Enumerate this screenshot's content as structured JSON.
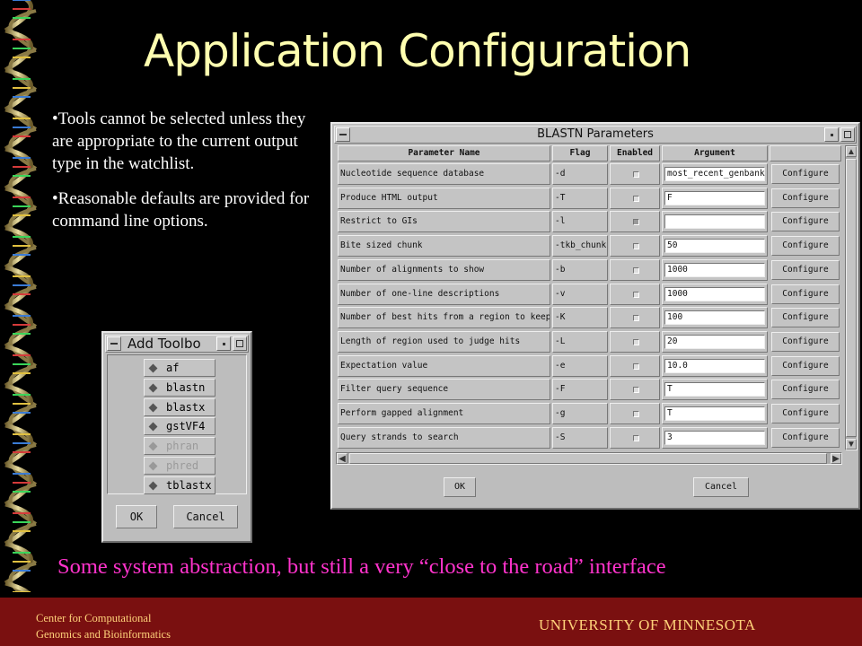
{
  "slide": {
    "title": "Application Configuration",
    "bullets": [
      "•Tools cannot be selected unless they are appropriate to the current output type in the watchlist.",
      "•Reasonable defaults are provided for command line options."
    ],
    "caption": "Some system abstraction, but still a very “close to the road” interface",
    "footer": {
      "left_line1": "Center for Computational",
      "left_line2": "Genomics and Bioinformatics",
      "right": "UNIVERSITY OF MINNESOTA"
    }
  },
  "blastn_window": {
    "title": "BLASTN Parameters",
    "headers": {
      "name": "Parameter Name",
      "flag": "Flag",
      "enabled": "Enabled",
      "argument": "Argument"
    },
    "rows": [
      {
        "name": "Nucleotide sequence database",
        "flag": "-d",
        "enabled": false,
        "argument": "most_recent_genbank",
        "button": "Configure"
      },
      {
        "name": "Produce HTML output",
        "flag": "-T",
        "enabled": false,
        "argument": "F",
        "button": "Configure"
      },
      {
        "name": "Restrict to GIs",
        "flag": "-l",
        "enabled": true,
        "argument": "",
        "button": "Configure"
      },
      {
        "name": "Bite sized chunk",
        "flag": "-tkb_chunk",
        "enabled": false,
        "argument": "50",
        "button": "Configure"
      },
      {
        "name": "Number of alignments to show",
        "flag": "-b",
        "enabled": false,
        "argument": "1000",
        "button": "Configure"
      },
      {
        "name": "Number of one-line descriptions",
        "flag": "-v",
        "enabled": false,
        "argument": "1000",
        "button": "Configure"
      },
      {
        "name": "Number of best hits from a region to keep",
        "flag": "-K",
        "enabled": false,
        "argument": "100",
        "button": "Configure"
      },
      {
        "name": "Length of region used to judge hits",
        "flag": "-L",
        "enabled": false,
        "argument": "20",
        "button": "Configure"
      },
      {
        "name": "Expectation value",
        "flag": "-e",
        "enabled": false,
        "argument": "10.0",
        "button": "Configure"
      },
      {
        "name": "Filter query sequence",
        "flag": "-F",
        "enabled": false,
        "argument": "T",
        "button": "Configure"
      },
      {
        "name": "Perform gapped alignment",
        "flag": "-g",
        "enabled": false,
        "argument": "T",
        "button": "Configure"
      },
      {
        "name": "Query strands to search",
        "flag": "-S",
        "enabled": false,
        "argument": "3",
        "button": "Configure"
      }
    ],
    "ok_label": "OK",
    "cancel_label": "Cancel"
  },
  "toolbox_window": {
    "title": "Add Toolbo",
    "tools": [
      {
        "label": "af",
        "enabled": true
      },
      {
        "label": "blastn",
        "enabled": true
      },
      {
        "label": "blastx",
        "enabled": true
      },
      {
        "label": "gstVF4",
        "enabled": true
      },
      {
        "label": "phran",
        "enabled": false
      },
      {
        "label": "phred",
        "enabled": false
      },
      {
        "label": "tblastx",
        "enabled": true
      }
    ],
    "ok_label": "OK",
    "cancel_label": "Cancel"
  }
}
